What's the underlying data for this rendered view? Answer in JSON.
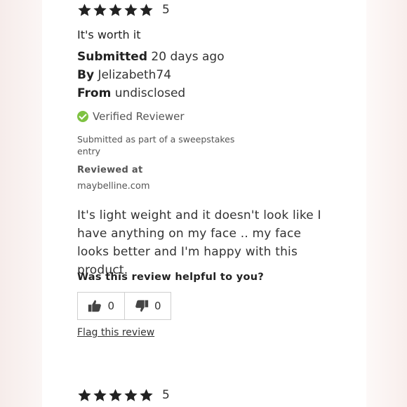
{
  "review1": {
    "rating": "5",
    "star_count": 5,
    "headline": "It's worth it",
    "submitted_label": "Submitted",
    "submitted_value": "20 days ago",
    "by_label": "By",
    "by_value": "Jelizabeth74",
    "from_label": "From",
    "from_value": "undisclosed",
    "verified": "Verified Reviewer",
    "sweepstakes": "Submitted as part of a sweepstakes entry",
    "reviewed_at_label": "Reviewed at",
    "reviewed_at_site": "maybelline.com",
    "body": "It's light weight and it doesn't look like I have anything on my face .. my face looks better and I'm happy with this product.",
    "helpful_question": "Was this review helpful to you?",
    "helpful_yes_count": "0",
    "helpful_no_count": "0",
    "flag_label": "Flag this review"
  },
  "review2": {
    "rating": "5",
    "star_count": 5
  },
  "colors": {
    "star": "#222222",
    "verified_check": "#7ec242",
    "text": "#333333"
  },
  "icons": {
    "star": "star-icon",
    "verified": "check-circle-icon",
    "thumbs_up": "thumbs-up-icon",
    "thumbs_down": "thumbs-down-icon"
  }
}
